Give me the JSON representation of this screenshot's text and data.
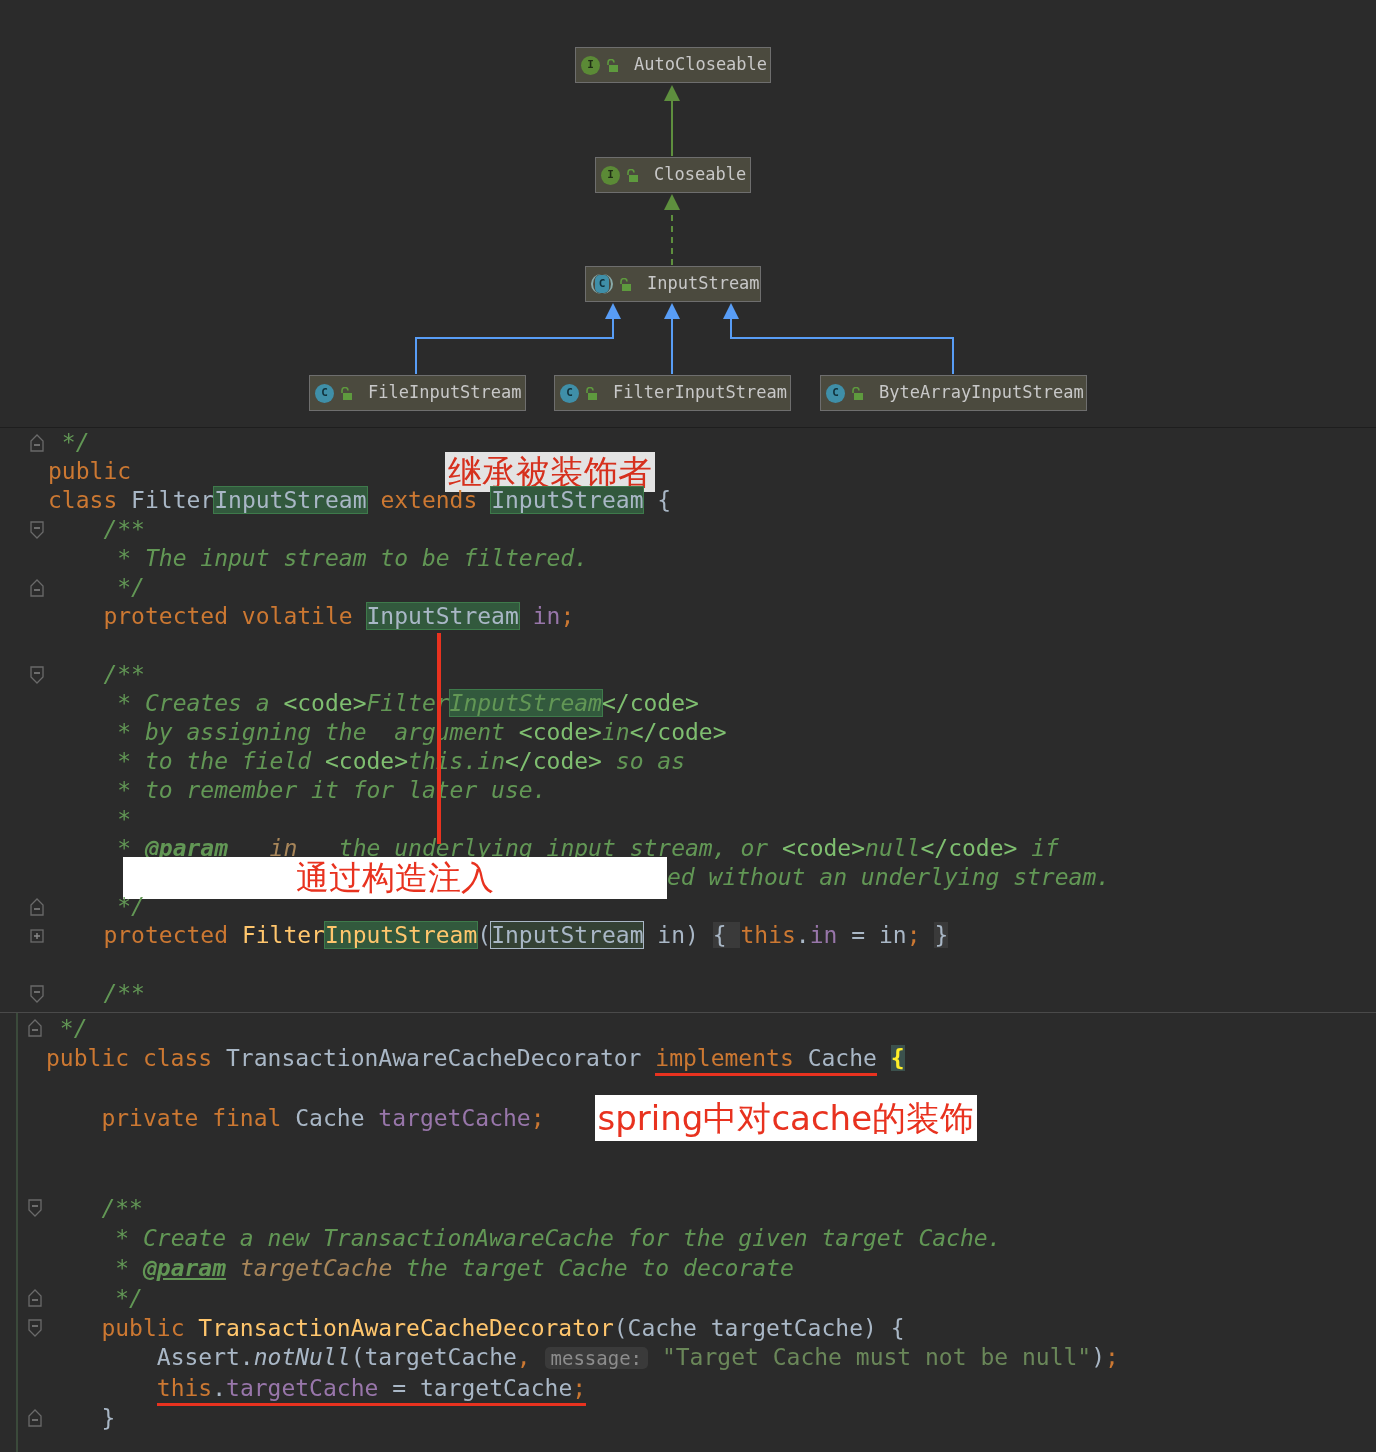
{
  "diagram": {
    "nodes": [
      {
        "label": "AutoCloseable",
        "icon": "I",
        "kind": "interface"
      },
      {
        "label": "Closeable",
        "icon": "I",
        "kind": "interface",
        "edge": {
          "dashed": false,
          "color": "#5e8f3e"
        }
      },
      {
        "label": "InputStream",
        "icon": "C",
        "kind": "abstract",
        "edge": {
          "dashed": true,
          "color": "#5e8f3e"
        }
      },
      {
        "label": "FileInputStream",
        "icon": "C",
        "kind": "class",
        "edge": {
          "dashed": false,
          "color": "#589df6"
        }
      },
      {
        "label": "FilterInputStream",
        "icon": "C",
        "kind": "class",
        "edge": {
          "dashed": false,
          "color": "#589df6"
        }
      },
      {
        "label": "ByteArrayInputStream",
        "icon": "C",
        "kind": "class",
        "edge": {
          "dashed": false,
          "color": "#589df6"
        }
      }
    ]
  },
  "panels": [
    {
      "lines": [
        {
          "kind": "fold-end",
          "tokens": [
            {
              "text": " */",
              "kind": "cm"
            }
          ]
        },
        {
          "kind": "plain",
          "tokens": [
            {
              "text": "public",
              "kind": "kw"
            },
            {
              "text": "继承被装饰者",
              "kind": "callout"
            }
          ]
        },
        {
          "kind": "plain",
          "tokens": [
            {
              "text": "class ",
              "kind": "kw"
            },
            {
              "text": "Filter",
              "kind": "plain"
            },
            {
              "text": "InputStream",
              "kind": "plain",
              "highlighted": true
            },
            {
              "text": " extends ",
              "kind": "kw"
            },
            {
              "text": "InputStream",
              "kind": "plain",
              "highlighted": true
            },
            {
              "text": " {",
              "kind": "plain"
            }
          ]
        },
        {
          "kind": "fold-start",
          "tokens": [
            {
              "text": "    /**",
              "kind": "cm"
            }
          ]
        },
        {
          "kind": "plain",
          "tokens": [
            {
              "text": "     * The input stream to be filtered.",
              "kind": "cm"
            }
          ]
        },
        {
          "kind": "fold-end",
          "tokens": [
            {
              "text": "     */",
              "kind": "cm"
            }
          ]
        },
        {
          "kind": "plain",
          "tokens": [
            {
              "text": "    protected volatile ",
              "kind": "kw"
            },
            {
              "text": "InputStream",
              "kind": "plain",
              "highlighted": true
            },
            {
              "text": " in",
              "kind": "fld"
            },
            {
              "text": ";",
              "kind": "kw"
            }
          ]
        },
        {
          "kind": "plain"
        },
        {
          "kind": "fold-start",
          "tokens": [
            {
              "text": "    /**",
              "kind": "cm"
            }
          ]
        },
        {
          "kind": "plain",
          "tokens": [
            {
              "text": "     * Creates a ",
              "kind": "cm"
            },
            {
              "text": "<code>",
              "kind": "ctag"
            },
            {
              "text": "Filter",
              "kind": "cm"
            },
            {
              "text": "InputStream",
              "kind": "cm",
              "highlighted": true
            },
            {
              "text": "</code>",
              "kind": "ctag"
            }
          ]
        },
        {
          "kind": "plain",
          "tokens": [
            {
              "text": "     * by assigning the  argument ",
              "kind": "cm"
            },
            {
              "text": "<code>",
              "kind": "ctag"
            },
            {
              "text": "in",
              "kind": "cm"
            },
            {
              "text": "</code>",
              "kind": "ctag"
            }
          ]
        },
        {
          "kind": "plain",
          "tokens": [
            {
              "text": "     * to the field ",
              "kind": "cm"
            },
            {
              "text": "<code>",
              "kind": "ctag"
            },
            {
              "text": "this.in",
              "kind": "cm"
            },
            {
              "text": "</code>",
              "kind": "ctag"
            },
            {
              "text": " so as",
              "kind": "cm"
            }
          ]
        },
        {
          "kind": "plain",
          "tokens": [
            {
              "text": "     * to remember it for later use.",
              "kind": "cm"
            }
          ]
        },
        {
          "kind": "plain",
          "tokens": [
            {
              "text": "     *",
              "kind": "cm"
            }
          ]
        },
        {
          "kind": "plain",
          "tokens": [
            {
              "text": "     * ",
              "kind": "cm"
            },
            {
              "text": "@param",
              "kind": "doctag"
            },
            {
              "text": "   in",
              "kind": "param"
            },
            {
              "text": "   the underlying input stream, or ",
              "kind": "cm"
            },
            {
              "text": "<code>",
              "kind": "ctag"
            },
            {
              "text": "null",
              "kind": "cm"
            },
            {
              "text": "</code>",
              "kind": "ctag"
            },
            {
              "text": " if",
              "kind": "cm"
            }
          ]
        },
        {
          "kind": "plain",
          "tokens": [
            {
              "text": "通过构造注入",
              "kind": "callout"
            },
            {
              "text": "ed without an underlying stream.",
              "kind": "cm"
            }
          ]
        },
        {
          "kind": "fold-end",
          "tokens": [
            {
              "text": "     */",
              "kind": "cm"
            }
          ]
        },
        {
          "kind": "collapsed",
          "tokens": [
            {
              "text": "    protected ",
              "kind": "kw"
            },
            {
              "text": "Filter",
              "kind": "meth"
            },
            {
              "text": "InputStream",
              "kind": "meth",
              "highlighted": true
            },
            {
              "text": "(",
              "kind": "plain"
            },
            {
              "text": "InputStream",
              "kind": "plain",
              "boxed": true
            },
            {
              "text": " in)",
              "kind": "plain"
            },
            {
              "text": " { ",
              "kind": "plain",
              "folded": true
            },
            {
              "text": "this",
              "kind": "kw"
            },
            {
              "text": ".",
              "kind": "plain"
            },
            {
              "text": "in",
              "kind": "fld"
            },
            {
              "text": " = in",
              "kind": "plain"
            },
            {
              "text": ";",
              "kind": "kw"
            },
            {
              "text": " }",
              "kind": "plain",
              "folded": true
            }
          ]
        },
        {
          "kind": "plain"
        },
        {
          "kind": "fold-start",
          "tokens": [
            {
              "text": "    /**",
              "kind": "cm"
            }
          ]
        }
      ]
    },
    {
      "lines": [
        {
          "kind": "fold-end",
          "tokens": [
            {
              "text": " */",
              "kind": "cm"
            }
          ]
        },
        {
          "kind": "plain",
          "tokens": [
            {
              "text": "public class ",
              "kind": "kw"
            },
            {
              "text": "TransactionAwareCacheDecorator ",
              "kind": "plain"
            },
            {
              "text": "implements",
              "kind": "kw",
              "underlined": true
            },
            {
              "text": " Cache",
              "kind": "plain",
              "underlined": true
            },
            {
              "text": " {",
              "kind": "brace"
            }
          ]
        },
        {
          "kind": "plain"
        },
        {
          "kind": "plain",
          "tokens": [
            {
              "text": "    private final ",
              "kind": "kw"
            },
            {
              "text": "Cache ",
              "kind": "plain"
            },
            {
              "text": "targetCache",
              "kind": "fld"
            },
            {
              "text": ";",
              "kind": "kw"
            },
            {
              "text": "spring中对cache的装饰",
              "kind": "callout"
            }
          ]
        },
        {
          "kind": "plain"
        },
        {
          "kind": "plain"
        },
        {
          "kind": "fold-start",
          "tokens": [
            {
              "text": "    /**",
              "kind": "cm"
            }
          ]
        },
        {
          "kind": "plain",
          "tokens": [
            {
              "text": "     * Create a new TransactionAwareCache for the given target Cache.",
              "kind": "cm"
            }
          ]
        },
        {
          "kind": "plain",
          "tokens": [
            {
              "text": "     * ",
              "kind": "cm"
            },
            {
              "text": "@param",
              "kind": "doctag"
            },
            {
              "text": " targetCache",
              "kind": "param"
            },
            {
              "text": " the target Cache to decorate",
              "kind": "cm"
            }
          ]
        },
        {
          "kind": "fold-end",
          "tokens": [
            {
              "text": "     */",
              "kind": "cm"
            }
          ]
        },
        {
          "kind": "fold-start",
          "tokens": [
            {
              "text": "    public ",
              "kind": "kw"
            },
            {
              "text": "TransactionAwareCacheDecorator",
              "kind": "meth"
            },
            {
              "text": "(Cache targetCache) {",
              "kind": "plain"
            }
          ]
        },
        {
          "kind": "plain",
          "tokens": [
            {
              "text": "        Assert.",
              "kind": "plain"
            },
            {
              "text": "notNull",
              "kind": "ital"
            },
            {
              "text": "(targetCache",
              "kind": "plain"
            },
            {
              "text": ",",
              "kind": "kw"
            },
            {
              "text": " message:",
              "kind": "hint"
            },
            {
              "text": " \"Target Cache must not be null\"",
              "kind": "str"
            },
            {
              "text": ")",
              "kind": "plain"
            },
            {
              "text": ";",
              "kind": "kw"
            }
          ]
        },
        {
          "kind": "plain",
          "tokens": [
            {
              "text": "        this",
              "kind": "kw",
              "underlined": true
            },
            {
              "text": ".",
              "kind": "plain",
              "underlined": true
            },
            {
              "text": "targetCache",
              "kind": "fld",
              "underlined": true
            },
            {
              "text": " = targetCache",
              "kind": "plain",
              "underlined": true
            },
            {
              "text": ";",
              "kind": "kw",
              "underlined": true
            }
          ]
        },
        {
          "kind": "fold-end",
          "tokens": [
            {
              "text": "    }",
              "kind": "plain"
            }
          ]
        }
      ]
    }
  ]
}
